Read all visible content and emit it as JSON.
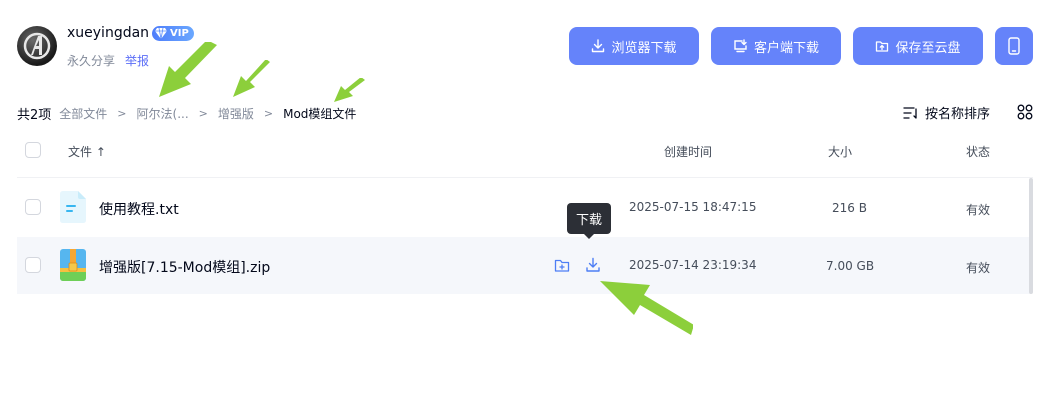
{
  "user": {
    "name": "xueyingdan",
    "vip_label": "VIP",
    "share_type": "永久分享",
    "report_label": "举报"
  },
  "actions": {
    "browser_download": "浏览器下载",
    "client_download": "客户端下载",
    "save_to_cloud": "保存至云盘"
  },
  "breadcrumb": {
    "total": "共2项",
    "items": [
      "全部文件",
      "阿尔法(...",
      "增强版",
      "Mod模组文件"
    ]
  },
  "sort_label": "按名称排序",
  "table": {
    "headers": {
      "name": "文件 ↑",
      "created": "创建时间",
      "size": "大小",
      "status": "状态"
    },
    "rows": [
      {
        "name": "使用教程.txt",
        "created": "2025-07-15 18:47:15",
        "size": "216 B",
        "status": "有效"
      },
      {
        "name": "增强版[7.15-Mod模组].zip",
        "created": "2025-07-14 23:19:34",
        "size": "7.00 GB",
        "status": "有效"
      }
    ]
  },
  "tooltip": "下载",
  "colors": {
    "primary": "#6583fa",
    "link": "#5b6ef7",
    "annotation_arrow": "#8ccf3b"
  }
}
